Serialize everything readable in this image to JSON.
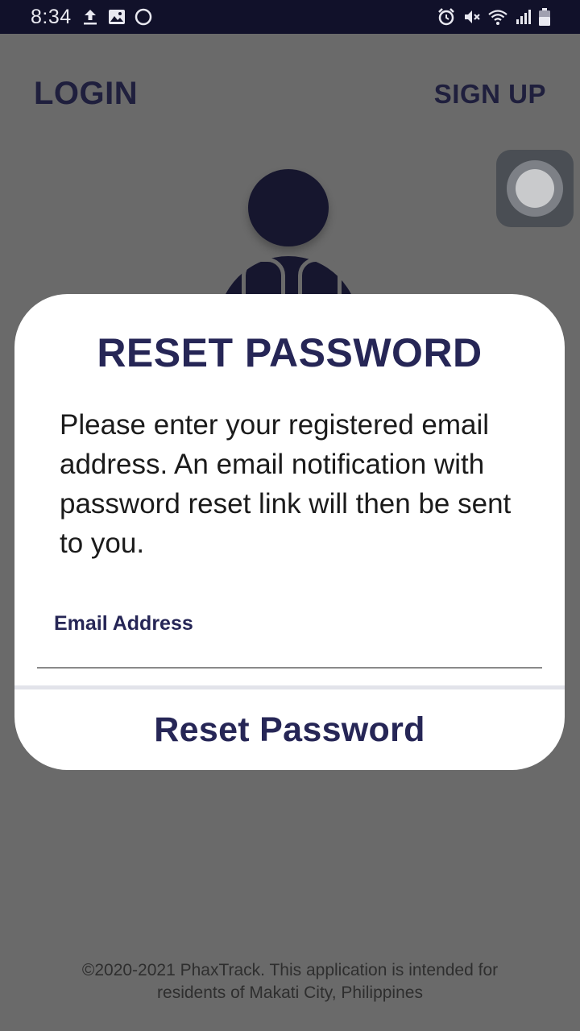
{
  "status_bar": {
    "time": "8:34",
    "left_icons": [
      "upload-icon",
      "image-icon",
      "circle-icon"
    ],
    "right_icons": [
      "alarm-icon",
      "mute-icon",
      "wifi-icon",
      "signal-icon",
      "battery-icon"
    ]
  },
  "header": {
    "login": "LOGIN",
    "signup": "SIGN UP"
  },
  "illustration": "doctor-icon",
  "modal": {
    "title": "RESET PASSWORD",
    "message": "Please enter your registered email address. An email notification with password reset link will then be sent to you.",
    "email_label": "Email Address",
    "email_value": "",
    "email_placeholder": "",
    "reset_button": "Reset Password"
  },
  "footer": {
    "line1": "©2020-2021 PhaxTrack. This application is intended for",
    "line2": "residents of Makati City, Philippines"
  },
  "colors": {
    "primary": "#262656",
    "overlay": "#6a6a6a",
    "statusbar": "#11112a"
  }
}
